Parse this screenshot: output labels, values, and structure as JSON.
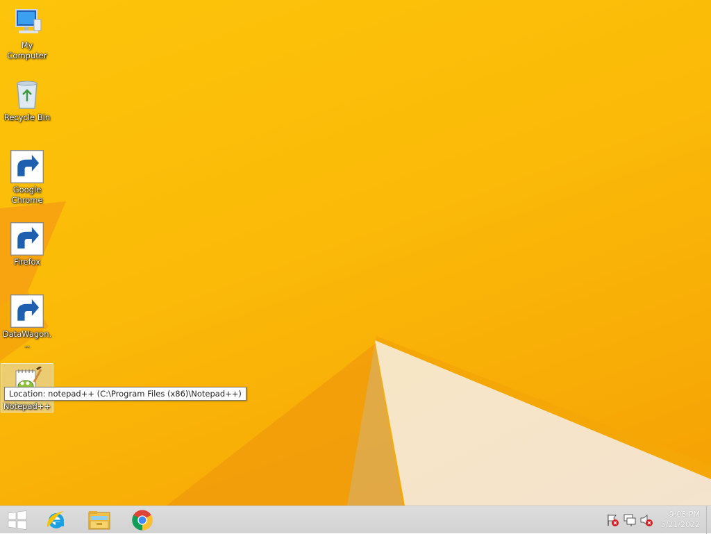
{
  "desktop": {
    "icons": [
      {
        "label": "My Computer",
        "icon": "computer-icon"
      },
      {
        "label": "Recycle Bin",
        "icon": "recycle-bin-icon"
      },
      {
        "label": "Google Chrome",
        "icon": "chrome-icon"
      },
      {
        "label": "Firefox",
        "icon": "firefox-icon"
      },
      {
        "label": "DataWagon...",
        "icon": "datawagon-icon"
      },
      {
        "label": "Notepad++",
        "icon": "notepad-plus-plus-icon"
      }
    ],
    "selected_icon": "Notepad++",
    "tooltip": "Location: notepad++ (C:\\Program Files (x86)\\Notepad++)"
  },
  "taskbar": {
    "pinned": [
      {
        "name": "Windows Start",
        "icon": "windows-logo-icon"
      },
      {
        "name": "Internet Explorer",
        "icon": "internet-explorer-icon"
      },
      {
        "name": "File Explorer",
        "icon": "file-explorer-icon"
      },
      {
        "name": "Google Chrome",
        "icon": "chrome-icon"
      }
    ],
    "tray": {
      "icons": [
        "action-center-flag-icon",
        "network-icon",
        "volume-muted-icon"
      ],
      "time": "9:08 PM",
      "date": "5/21/2022"
    }
  },
  "colors": {
    "wallpaper": "#fbba08",
    "taskbar": "#d8d8d8",
    "tray_alert": "#d6191f"
  }
}
